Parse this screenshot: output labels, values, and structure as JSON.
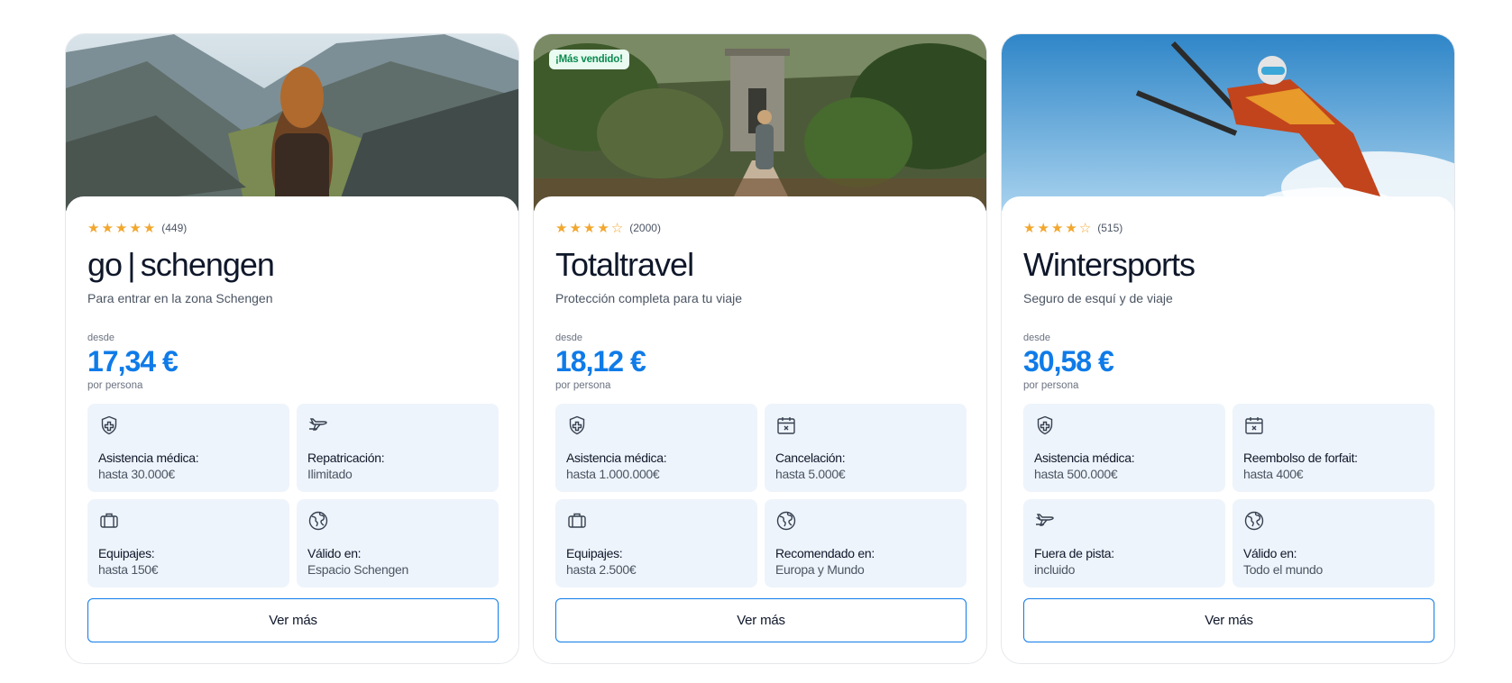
{
  "cards": [
    {
      "badge": "",
      "rating_count": "(449)",
      "stars": 5,
      "title": "go | schengen",
      "subtitle": "Para entrar en la zona Schengen",
      "desde": "desde",
      "price": "17,34 €",
      "per": "por persona",
      "features": [
        {
          "icon": "medical-shield-icon",
          "title": "Asistencia médica:",
          "value": "hasta 30.000€"
        },
        {
          "icon": "airplane-icon",
          "title": "Repatricación:",
          "value": "Ilimitado"
        },
        {
          "icon": "luggage-icon",
          "title": "Equipajes:",
          "value": "hasta 150€"
        },
        {
          "icon": "globe-icon",
          "title": "Válido en:",
          "value": "Espacio Schengen"
        }
      ],
      "button": "Ver más"
    },
    {
      "badge": "¡Más vendido!",
      "rating_count": "(2000)",
      "stars": 4,
      "title": "Totaltravel",
      "subtitle": "Protección completa para tu viaje",
      "desde": "desde",
      "price": "18,12 €",
      "per": "por persona",
      "features": [
        {
          "icon": "medical-shield-icon",
          "title": "Asistencia médica:",
          "value": "hasta 1.000.000€"
        },
        {
          "icon": "calendar-cancel-icon",
          "title": "Cancelación:",
          "value": "hasta 5.000€"
        },
        {
          "icon": "luggage-icon",
          "title": "Equipajes:",
          "value": "hasta 2.500€"
        },
        {
          "icon": "globe-icon",
          "title": "Recomendado en:",
          "value": "Europa y Mundo"
        }
      ],
      "button": "Ver más"
    },
    {
      "badge": "",
      "rating_count": "(515)",
      "stars": 4,
      "title": "Wintersports",
      "subtitle": "Seguro de esquí y de viaje",
      "desde": "desde",
      "price": "30,58 €",
      "per": "por persona",
      "features": [
        {
          "icon": "medical-shield-icon",
          "title": "Asistencia médica:",
          "value": "hasta 500.000€"
        },
        {
          "icon": "calendar-cancel-icon",
          "title": "Reembolso de forfait:",
          "value": "hasta 400€"
        },
        {
          "icon": "airplane-icon",
          "title": "Fuera de pista:",
          "value": "incluido"
        },
        {
          "icon": "globe-icon",
          "title": "Válido en:",
          "value": "Todo el mundo"
        }
      ],
      "button": "Ver más"
    }
  ]
}
